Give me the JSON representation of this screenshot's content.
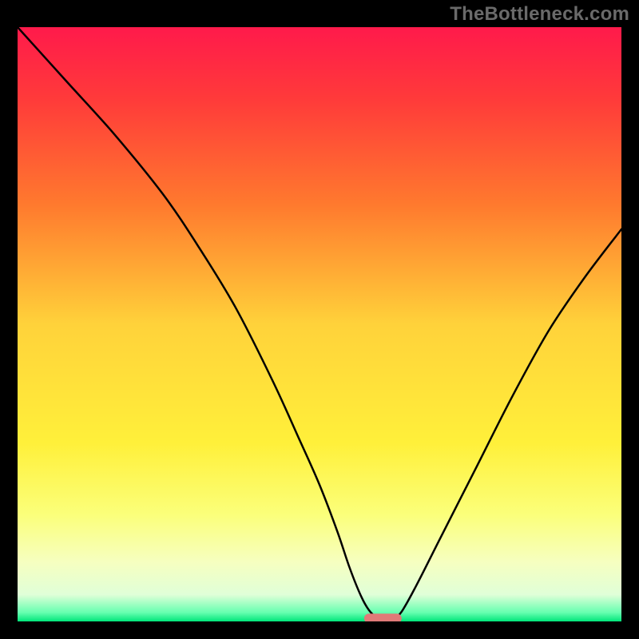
{
  "watermark": "TheBottleneck.com",
  "chart_data": {
    "type": "line",
    "title": "",
    "xlabel": "",
    "ylabel": "",
    "xlim": [
      0,
      100
    ],
    "ylim": [
      0,
      100
    ],
    "grid": false,
    "gradient_stops": [
      {
        "offset": 0.0,
        "color": "#ff1a4b"
      },
      {
        "offset": 0.12,
        "color": "#ff3a3a"
      },
      {
        "offset": 0.3,
        "color": "#ff7a2e"
      },
      {
        "offset": 0.5,
        "color": "#ffd23a"
      },
      {
        "offset": 0.7,
        "color": "#fff03a"
      },
      {
        "offset": 0.82,
        "color": "#fbff7a"
      },
      {
        "offset": 0.9,
        "color": "#f6ffc0"
      },
      {
        "offset": 0.955,
        "color": "#e0ffd8"
      },
      {
        "offset": 0.985,
        "color": "#66ffb0"
      },
      {
        "offset": 1.0,
        "color": "#00e57a"
      }
    ],
    "series": [
      {
        "name": "bottleneck-curve",
        "x": [
          0,
          8,
          16,
          24,
          30,
          36,
          42,
          46.5,
          50,
          53,
          55,
          57,
          58.5,
          60,
          62,
          63.5,
          66,
          70,
          76,
          82,
          88,
          94,
          100
        ],
        "y": [
          100,
          91,
          82,
          72,
          63,
          53,
          41,
          31,
          23,
          15,
          9,
          4,
          1.5,
          0.5,
          0.5,
          1.5,
          6,
          14,
          26,
          38,
          49,
          58,
          66
        ]
      }
    ],
    "marker": {
      "x": 60.5,
      "y": 0.5,
      "width": 6.2,
      "height": 1.6,
      "color": "#e07a78"
    }
  }
}
